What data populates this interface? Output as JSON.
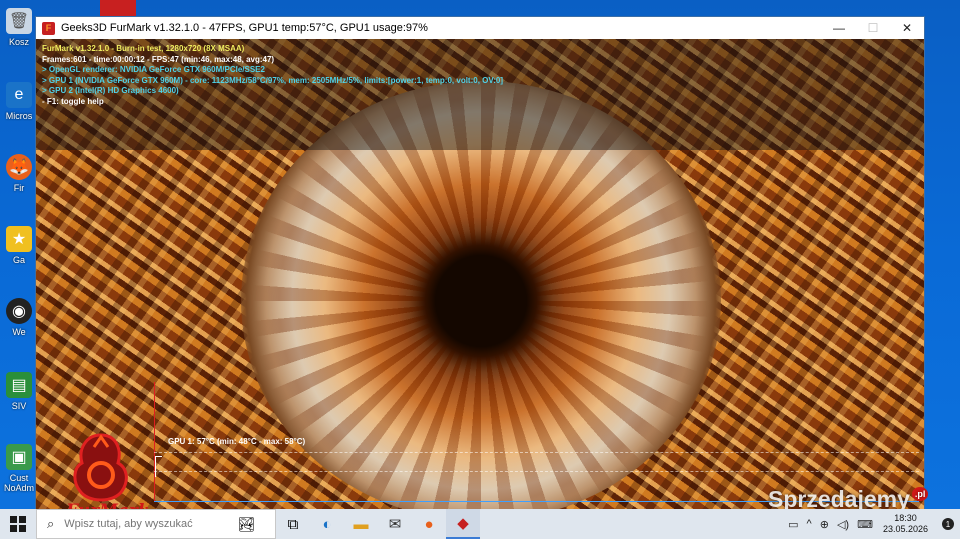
{
  "window": {
    "title": "Geeks3D FurMark v1.32.1.0 - 47FPS, GPU1 temp:57°C, GPU1 usage:97%",
    "app_icon_letter": "F",
    "minimize": "—",
    "maximize": "☐",
    "close": "✕"
  },
  "osd": {
    "line1": "FurMark v1.32.1.0 - Burn-in test, 1280x720 (8X MSAA)",
    "line2": "Frames:601 - time:00:00:12 - FPS:47 (min:46, max:48, avg:47)",
    "line3": "> OpenGL renderer: NVIDIA GeForce GTX 960M/PCIe/SSE2",
    "line4": "> GPU 1 (NVIDIA GeForce GTX 960M) - core: 1123MHz/58°C/97%, mem: 2505MHz/5%, limits:[power:1, temp:0, volt:0, OV:0]",
    "line5": "> GPU 2 (Intel(R) HD Graphics 4600)",
    "line6": "- F1: toggle help"
  },
  "graph": {
    "label": "GPU 1: 57°C (min: 48°C - max: 58°C)"
  },
  "logo": {
    "brand": "FurMark"
  },
  "watermark": {
    "text": "Sprzedajemy",
    "suffix": ".pl"
  },
  "desktop_icons": [
    {
      "label": "Kosz",
      "icon": "recycle-bin-icon"
    },
    {
      "label": "Micros",
      "icon": "edge-icon"
    },
    {
      "label": "Fir",
      "icon": "firefox-icon"
    },
    {
      "label": "Ga",
      "icon": "game-icon"
    },
    {
      "label": "We",
      "icon": "webcam-icon"
    },
    {
      "label": "SIV",
      "icon": "siv-icon"
    },
    {
      "label": "Cust\nNoAdm",
      "icon": "custom-icon"
    }
  ],
  "taskbar": {
    "search_placeholder": "Wpisz tutaj, aby wyszukać",
    "time": "18:30",
    "date": "23.05.2026",
    "notification_count": "1"
  },
  "colors": {
    "osd_title": "#f0ee60",
    "osd_info": "#4fd2e8",
    "graph_axis": "#e02020"
  }
}
